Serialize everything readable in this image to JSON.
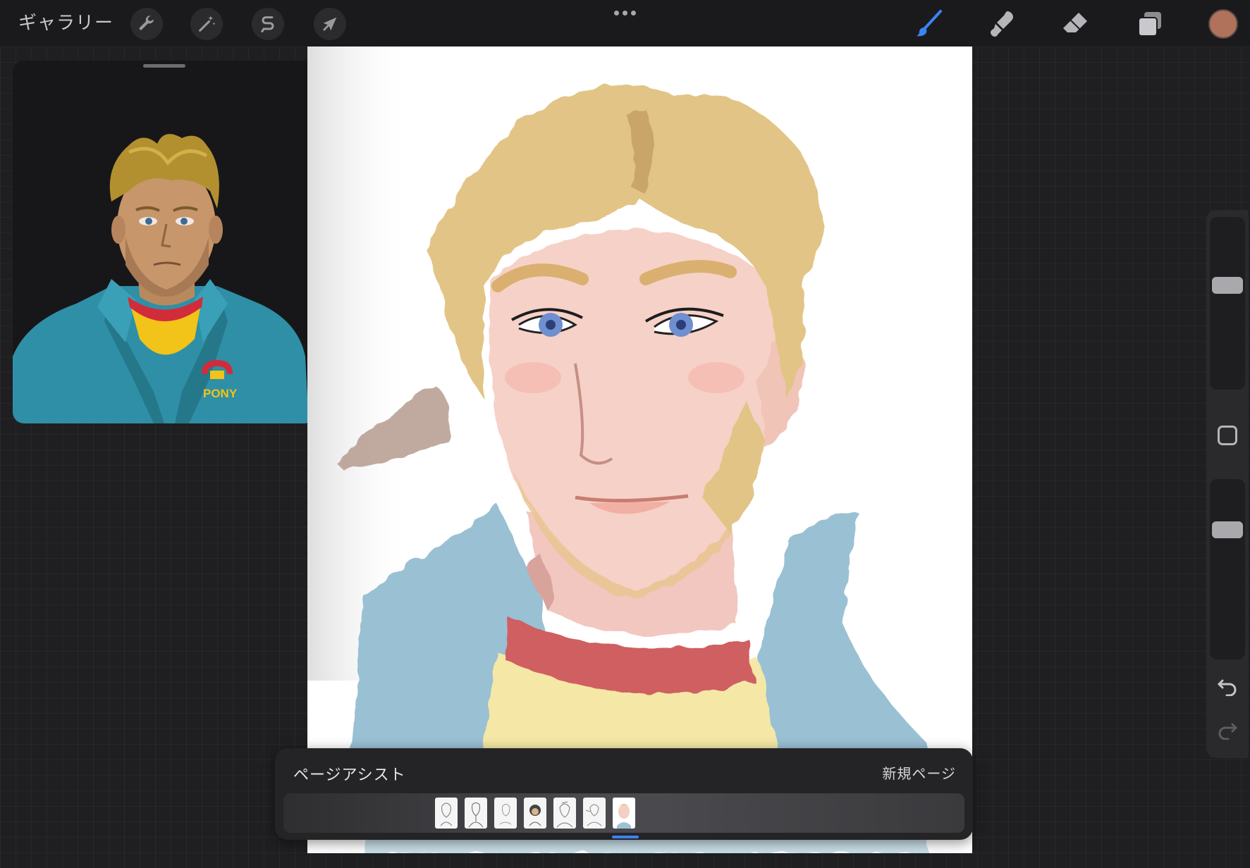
{
  "toolbar": {
    "gallery_label": "ギャラリー",
    "left_tools": [
      {
        "name": "actions",
        "icon": "wrench-icon"
      },
      {
        "name": "adjustments",
        "icon": "magic-wand-icon"
      },
      {
        "name": "selection",
        "icon": "selection-s-icon"
      },
      {
        "name": "transform",
        "icon": "arrow-cursor-icon"
      }
    ],
    "right_tools": [
      {
        "name": "brush",
        "icon": "brush-icon",
        "active": true
      },
      {
        "name": "smudge",
        "icon": "smudge-icon",
        "active": false
      },
      {
        "name": "eraser",
        "icon": "eraser-icon",
        "active": false
      },
      {
        "name": "layers",
        "icon": "layers-icon",
        "active": false
      }
    ],
    "current_color": "#b0725a",
    "accent_color": "#3b82f6"
  },
  "reference_panel": {
    "logo_text": "PONY"
  },
  "sidebar": {
    "brush_size_level": 0.62,
    "opacity_level": 0.75
  },
  "page_assist": {
    "title": "ページアシスト",
    "new_page_label": "新規ページ",
    "page_count": 7,
    "selected_page_index": 6
  }
}
